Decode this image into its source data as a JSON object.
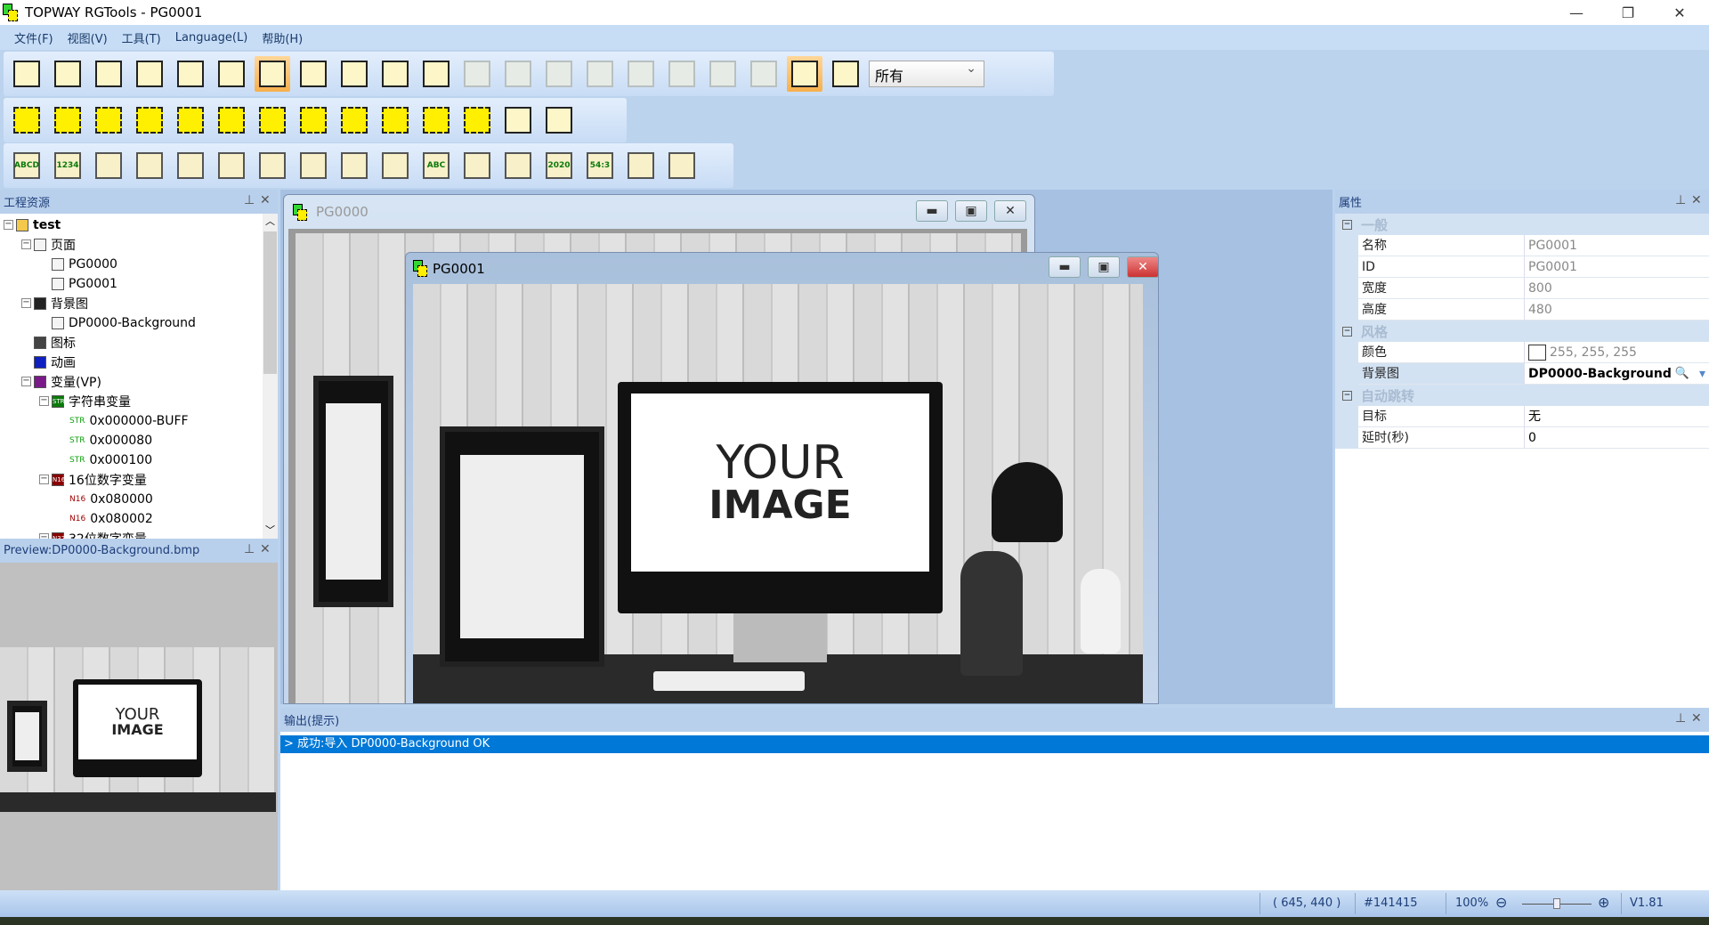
{
  "window": {
    "title": "TOPWAY RGTools - PG0001",
    "minimize": "—",
    "restore": "❐",
    "close": "✕"
  },
  "menu": [
    "文件(F)",
    "视图(V)",
    "工具(T)",
    "Language(L)",
    "帮助(H)"
  ],
  "toolbar": {
    "row1": [
      "new-project-icon",
      "open-project-icon",
      "save-icon",
      "export-icon",
      "settings-icon",
      "font-icon",
      "select-pointer-icon",
      "copy-icon",
      "paste-icon",
      "undo-icon",
      "redo-icon",
      "align-left-icon",
      "align-right-icon",
      "align-top-icon",
      "align-bottom-icon",
      "align-hcenter-icon",
      "align-vcenter-icon",
      "same-width-icon",
      "same-height-icon",
      "preview-on-icon",
      "preview-off-icon"
    ],
    "filter_value": "所有",
    "row2": [
      "touch-area-icon",
      "vpk-area-icon",
      "esc-key-icon",
      "backspace-key-icon",
      "left-key-icon",
      "right-key-icon",
      "enter-key-icon",
      "shift-key-icon",
      "char-key-icon",
      "keypad-icon",
      "keypad-alt-icon",
      "keyboard-icon",
      "download-script-icon",
      "download-icon"
    ],
    "row3": [
      "text-icon",
      "number-icon",
      "bar-icon",
      "rotate-icon",
      "icon-icon",
      "gauge-icon",
      "icon-animation-icon",
      "curve-icon",
      "slider-icon",
      "qr-icon",
      "text-box-icon",
      "touch-icon-icon",
      "animation-icon",
      "datetime-icon",
      "time-icon",
      "crop-icon",
      "table-icon"
    ],
    "row3_labels": {
      "text-icon": "ABCD",
      "number-icon": "1234",
      "text-box-icon": "ABC",
      "datetime-icon": "2020",
      "time-icon": "54:3"
    }
  },
  "project_panel": {
    "title": "工程资源",
    "tree": [
      {
        "label": "test",
        "level": 0,
        "bold": true,
        "icon": "folder-icon"
      },
      {
        "label": "页面",
        "level": 1,
        "icon": "pages-icon"
      },
      {
        "label": "PG0000",
        "level": 2,
        "icon": "page-icon"
      },
      {
        "label": "PG0001",
        "level": 2,
        "icon": "page-icon"
      },
      {
        "label": "背景图",
        "level": 1,
        "icon": "background-icon"
      },
      {
        "label": "DP0000-Background",
        "level": 2,
        "icon": "image-icon"
      },
      {
        "label": "图标",
        "level": 1,
        "icon": "icon-library-icon"
      },
      {
        "label": "动画",
        "level": 1,
        "icon": "animation-icon"
      },
      {
        "label": "变量(VP)",
        "level": 1,
        "icon": "variable-icon"
      },
      {
        "label": "字符串变量",
        "level": 2,
        "icon": "string-var-icon",
        "tag": "STR"
      },
      {
        "label": "0x000000-BUFF",
        "level": 3,
        "tag": "STR"
      },
      {
        "label": "0x000080",
        "level": 3,
        "tag": "STR"
      },
      {
        "label": "0x000100",
        "level": 3,
        "tag": "STR"
      },
      {
        "label": "16位数字变量",
        "level": 2,
        "icon": "n16-var-icon",
        "tag": "N16"
      },
      {
        "label": "0x080000",
        "level": 3,
        "tag": "N16"
      },
      {
        "label": "0x080002",
        "level": 3,
        "tag": "N16"
      },
      {
        "label": "32位数字变量",
        "level": 2,
        "icon": "n32-var-icon",
        "tag": "N32"
      }
    ]
  },
  "preview_panel": {
    "title": "Preview:DP0000-Background.bmp"
  },
  "documents": [
    {
      "title": "PG0000"
    },
    {
      "title": "PG0001"
    }
  ],
  "image_text": {
    "line1": "YOUR",
    "line2": "IMAGE"
  },
  "properties": {
    "title": "属性",
    "groups": [
      {
        "name": "一般",
        "rows": [
          {
            "k": "名称",
            "v": "PG0001"
          },
          {
            "k": "ID",
            "v": "PG0001"
          },
          {
            "k": "宽度",
            "v": "800"
          },
          {
            "k": "高度",
            "v": "480"
          }
        ]
      },
      {
        "name": "风格",
        "rows": [
          {
            "k": "颜色",
            "v": "255, 255, 255",
            "swatch": "#ffffff"
          },
          {
            "k": "背景图",
            "v": "DP0000-Background",
            "bold": true
          }
        ]
      },
      {
        "name": "自动跳转",
        "rows": [
          {
            "k": "目标",
            "v": "无"
          },
          {
            "k": "延时(秒)",
            "v": "0"
          }
        ]
      }
    ]
  },
  "output": {
    "title": "输出(提示)",
    "lines": [
      "> 成功:导入 DP0000-Background OK"
    ]
  },
  "status": {
    "coords": "( 645, 440 )",
    "color": "#141415",
    "zoom": "100%",
    "zoom_fraction": 0.5,
    "version": "V1.81"
  },
  "colors": {
    "selection": "#0078d7",
    "panel_header": "#b9d0ec",
    "workspace": "#a7c1e3"
  }
}
